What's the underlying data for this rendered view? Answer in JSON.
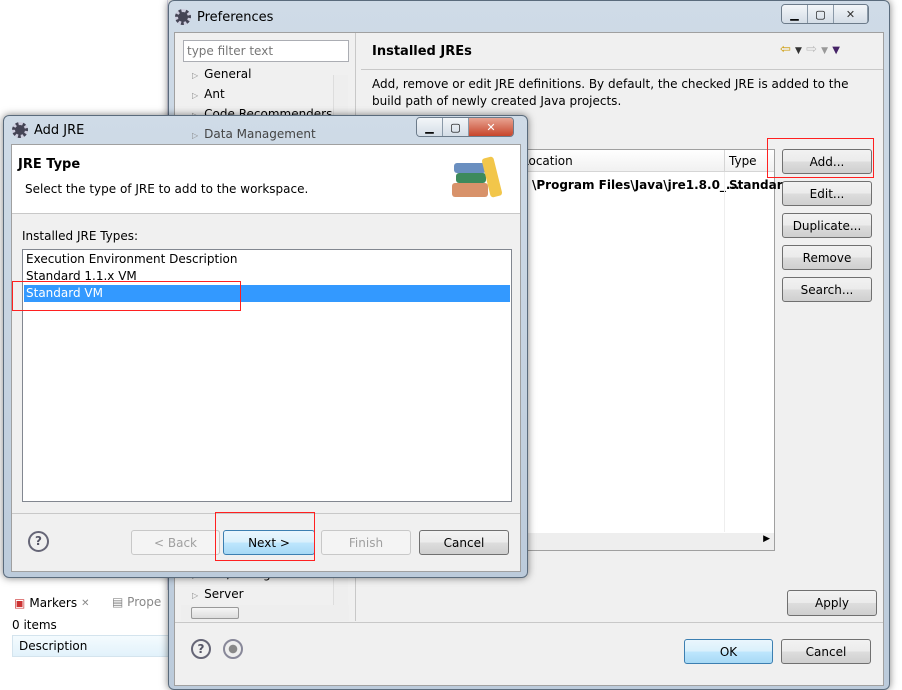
{
  "preferences": {
    "title": "Preferences",
    "filter_placeholder": "type filter text",
    "tree": [
      {
        "label": "General"
      },
      {
        "label": "Ant"
      },
      {
        "label": "Code Recommenders"
      },
      {
        "label": "Data Management"
      },
      {
        "label": "Run/Debug"
      },
      {
        "label": "Server"
      }
    ],
    "page_title": "Installed JREs",
    "description": "Add, remove or edit JRE definitions. By default, the checked JRE is added to the build path of newly created Java projects.",
    "table": {
      "columns": [
        "Location",
        "Type"
      ],
      "rows": [
        {
          "location": "\\Program Files\\Java\\jre1.8.0_...",
          "type": "Standar"
        }
      ]
    },
    "buttons": {
      "add": "Add...",
      "edit": "Edit...",
      "duplicate": "Duplicate...",
      "remove": "Remove",
      "search": "Search...",
      "apply": "Apply",
      "ok": "OK",
      "cancel": "Cancel"
    }
  },
  "dialog": {
    "title": "Add JRE",
    "header_title": "JRE Type",
    "header_desc": "Select the type of JRE to add to the workspace.",
    "list_label": "Installed JRE Types:",
    "items": [
      {
        "label": "Execution Environment Description"
      },
      {
        "label": "Standard 1.1.x VM"
      },
      {
        "label": "Standard VM",
        "selected": true
      }
    ],
    "buttons": {
      "back": "< Back",
      "next": "Next >",
      "finish": "Finish",
      "cancel": "Cancel"
    }
  },
  "markers": {
    "tab": "Markers",
    "tab2": "Prope",
    "count": "0 items",
    "column": "Description"
  },
  "colors": {
    "selection": "#3399ff",
    "highlight": "#ff2020"
  }
}
